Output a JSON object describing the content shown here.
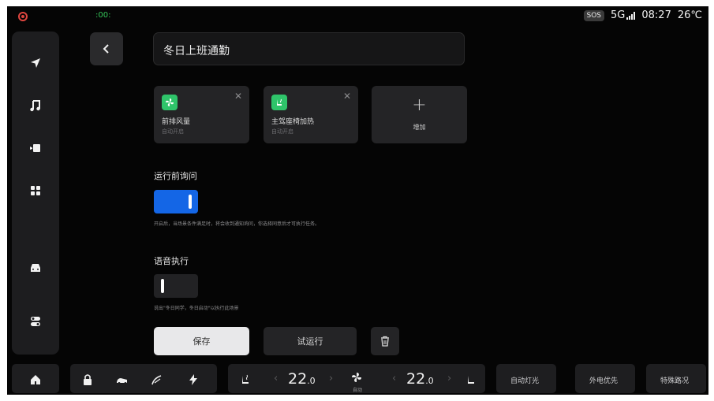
{
  "status": {
    "sos": "SOS",
    "network": "5G",
    "time": "08:27",
    "temperature": "26℃",
    "left_indicator": ":00:"
  },
  "sidebar": {
    "items": [
      {
        "icon": "navigation-icon"
      },
      {
        "icon": "music-icon"
      },
      {
        "icon": "video-icon"
      },
      {
        "icon": "apps-grid-icon"
      },
      {
        "icon": "car-icon"
      },
      {
        "icon": "settings-toggle-icon"
      }
    ]
  },
  "header": {
    "scene_name": "冬日上班通勤"
  },
  "actions": {
    "cards": [
      {
        "name": "前排风量",
        "sub": "自动开启",
        "icon": "fan-icon"
      },
      {
        "name": "主驾座椅加热",
        "sub": "自动开启",
        "icon": "seat-heat-icon"
      }
    ],
    "add_label": "增加"
  },
  "confirm_before_run": {
    "title": "运行前询问",
    "enabled": true,
    "hint": "开启后，当场景条件满足时，将会收到通知询问，你选择同意后才可执行任务。"
  },
  "voice_execute": {
    "title": "语音执行",
    "enabled": false,
    "hint": "说出\"冬日同学，冬日启动\"以执行此场景"
  },
  "buttons": {
    "save": "保存",
    "trial_run": "试运行"
  },
  "bottom_bar": {
    "left_temp": "22",
    "left_temp_decimal": ".0",
    "right_temp": "22",
    "right_temp_decimal": ".0",
    "fan_label": "自动",
    "auto_light": "自动灯光",
    "aux_power": "外电优先",
    "special_mode": "特殊路况"
  },
  "colors": {
    "accent_blue": "#1466e6",
    "card_icon_green": "#2fc46a",
    "status_red": "#e0463f"
  }
}
